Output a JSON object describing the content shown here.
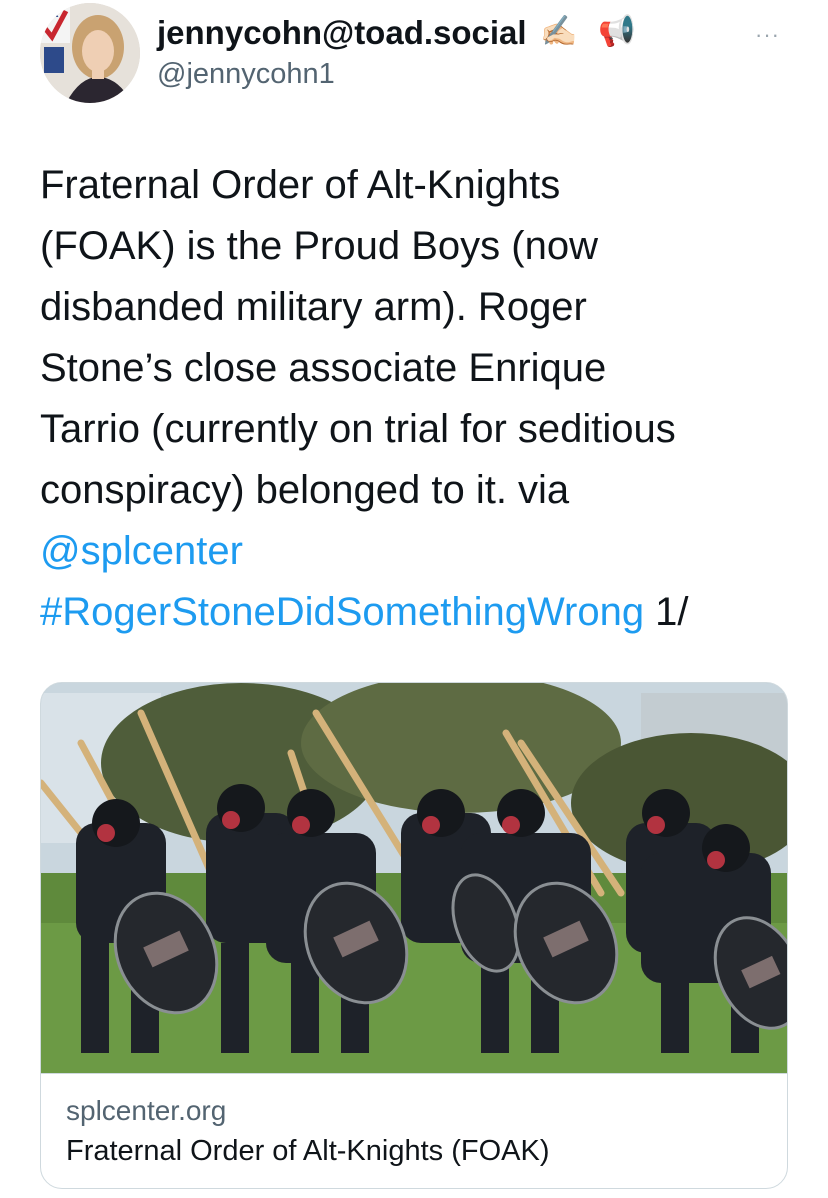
{
  "header": {
    "display_name": "jennycohn@toad.social",
    "name_emoji_1": "✍🏻",
    "name_emoji_2": "📢",
    "handle": "@jennycohn1",
    "more_label": "···",
    "avatar_icon": "avatar-photo"
  },
  "tweet": {
    "lines": [
      "Fraternal Order of Alt-Knights",
      "(FOAK) is the Proud Boys (now",
      "disbanded military arm). Roger",
      "Stone’s close associate Enrique",
      "Tarrio (currently on trial for seditious",
      "conspiracy) belonged to it. via"
    ],
    "mention": "@splcenter",
    "hashtag": "#RogerStoneDidSomethingWrong",
    "suffix": " 1/"
  },
  "card": {
    "domain": "splcenter.org",
    "title": "Fraternal Order of Alt-Knights (FOAK)",
    "image_icon": "photo-of-masked-men-with-shields"
  },
  "colors": {
    "link": "#1d9bf0",
    "text": "#0f1419",
    "muted": "#536471",
    "border": "#cfd9de"
  }
}
